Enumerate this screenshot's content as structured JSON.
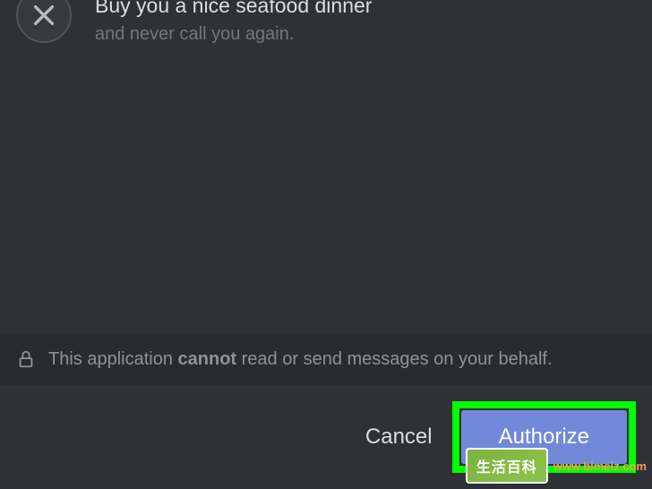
{
  "permission": {
    "title": "Buy you a nice seafood dinner",
    "subtitle": "and never call you again."
  },
  "notice": {
    "prefix": "This application ",
    "emphasis": "cannot",
    "suffix": " read or send messages on your behalf."
  },
  "actions": {
    "cancel": "Cancel",
    "authorize": "Authorize"
  },
  "watermark": {
    "badge": "生活百科",
    "url": "www.bimeiz.com"
  }
}
